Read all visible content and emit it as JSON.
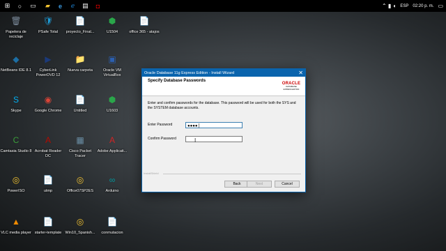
{
  "taskbar": {
    "language": "ESP",
    "clock": "02:20 p. m.",
    "icons": [
      "start-icon",
      "search-icon",
      "task-view-icon",
      "file-explorer-icon",
      "edge-icon",
      "internet-explorer-icon",
      "store-icon",
      "oracle-db-icon"
    ]
  },
  "desktop": {
    "icons": [
      {
        "label": "Papelera de reciclaje",
        "glyph": "🗑",
        "color": "#7b8a9a"
      },
      {
        "label": "PSafe Total",
        "glyph": "🛡",
        "color": "#1d9bd6"
      },
      {
        "label": "proyecto_Final...",
        "glyph": "📄",
        "color": "#ffffff"
      },
      {
        "label": "U1504",
        "glyph": "⬢",
        "color": "#2aa64a"
      },
      {
        "label": "office 365 - atajos",
        "glyph": "📄",
        "color": "#eeeeee"
      },
      {
        "label": "NetBeans IDE 8.1",
        "glyph": "◆",
        "color": "#1c6ea4"
      },
      {
        "label": "CyberLink PowerDVD 12",
        "glyph": "▶",
        "color": "#1b3a7a"
      },
      {
        "label": "Nueva carpeta",
        "glyph": "📁",
        "color": "#e8c15a"
      },
      {
        "label": "Oracle VM VirtualBox",
        "glyph": "▣",
        "color": "#2b5fb0"
      },
      {
        "label": "Skype",
        "glyph": "S",
        "color": "#00aff0"
      },
      {
        "label": "Google Chrome",
        "glyph": "◉",
        "color": "#db4437"
      },
      {
        "label": "Untitled",
        "glyph": "📄",
        "color": "#e8c15a"
      },
      {
        "label": "U1603",
        "glyph": "⬢",
        "color": "#2aa64a"
      },
      {
        "label": "Camtasia Studio 8",
        "glyph": "C",
        "color": "#3a9e3a"
      },
      {
        "label": "Acrobat Reader DC",
        "glyph": "A",
        "color": "#b30b00"
      },
      {
        "label": "Cisco Packet Tracer",
        "glyph": "▦",
        "color": "#6b8fa6"
      },
      {
        "label": "Adobe Applicati...",
        "glyph": "A",
        "color": "#d12424"
      },
      {
        "label": "PowerISO",
        "glyph": "◎",
        "color": "#f2c230"
      },
      {
        "label": "utmp",
        "glyph": "📄",
        "color": "#ffffff"
      },
      {
        "label": "Office07SP2ES",
        "glyph": "◎",
        "color": "#f2c230"
      },
      {
        "label": "Arduino",
        "glyph": "∞",
        "color": "#00979c"
      },
      {
        "label": "VLC media player",
        "glyph": "▲",
        "color": "#f08a00"
      },
      {
        "label": "starter-template",
        "glyph": "📄",
        "color": "#e8c15a"
      },
      {
        "label": "Win10_Spanish...",
        "glyph": "◎",
        "color": "#f2c230"
      },
      {
        "label": "conmutacion",
        "glyph": "📄",
        "color": "#ffffff"
      }
    ]
  },
  "dialog": {
    "window_title": "Oracle Database 11g Express Edition - Install Wizard",
    "step_title": "Specify Database Passwords",
    "logo": {
      "word": "ORACLE",
      "sub": "DATABASE",
      "sub2": "EXPRESS EDITION"
    },
    "instructions": "Enter and confirm passwords for the database. This password will be used for both the SYS and the SYSTEM database accounts.",
    "enter_password_label": "Enter Password",
    "enter_password_value": "●●●●",
    "confirm_password_label": "Confirm Password",
    "confirm_password_value": "",
    "installshield_label": "InstallShield",
    "buttons": {
      "back": "Back",
      "next": "Next",
      "cancel": "Cancel"
    }
  }
}
